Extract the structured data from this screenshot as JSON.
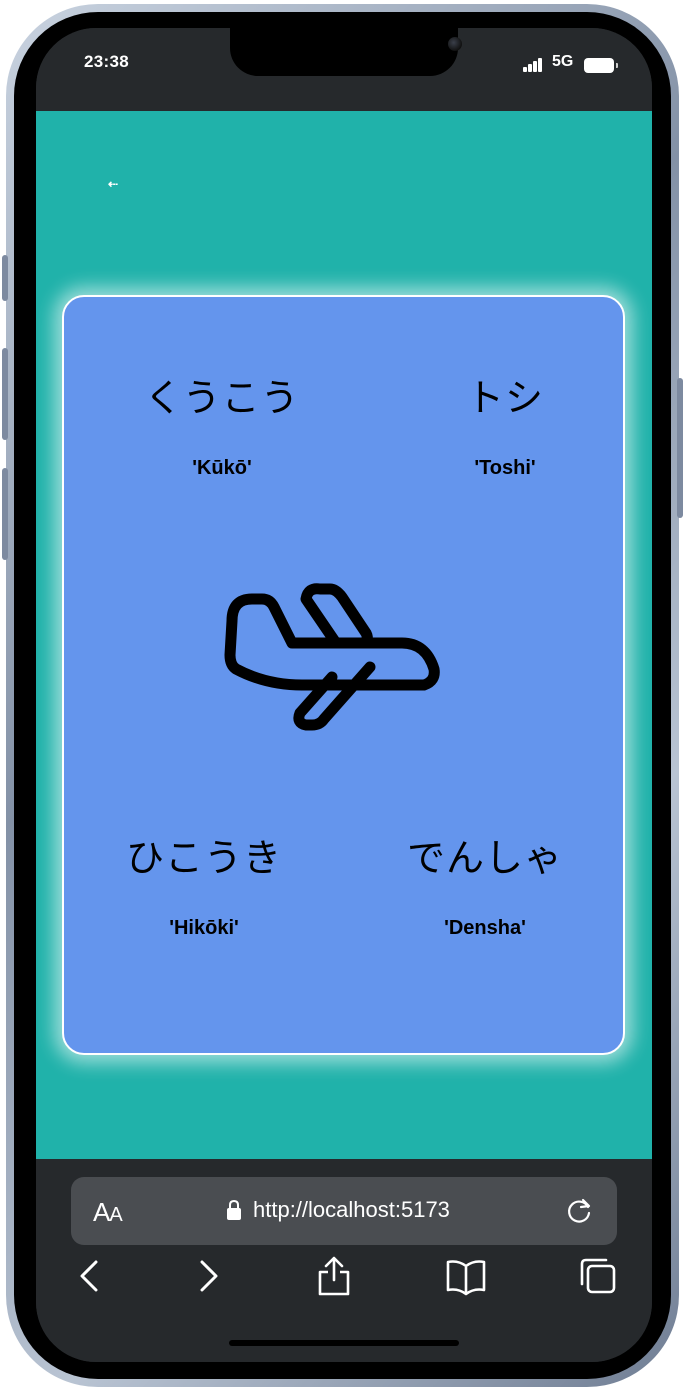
{
  "status_bar": {
    "time": "23:38",
    "network": "5G"
  },
  "app": {
    "back_label": "⇠",
    "words": [
      {
        "japanese": "くうこう",
        "romaji": "'Kūkō'"
      },
      {
        "japanese": "トシ",
        "romaji": "'Toshi'"
      },
      {
        "japanese": "ひこうき",
        "romaji": "'Hikōki'"
      },
      {
        "japanese": "でんしゃ",
        "romaji": "'Densha'"
      }
    ],
    "center_icon": "airplane-icon"
  },
  "browser": {
    "text_size_label": "A",
    "text_size_small": "A",
    "url": "http://localhost:5173"
  },
  "colors": {
    "background": "#20b2aa",
    "card": "#6495ed",
    "browser_chrome": "#26292c"
  }
}
